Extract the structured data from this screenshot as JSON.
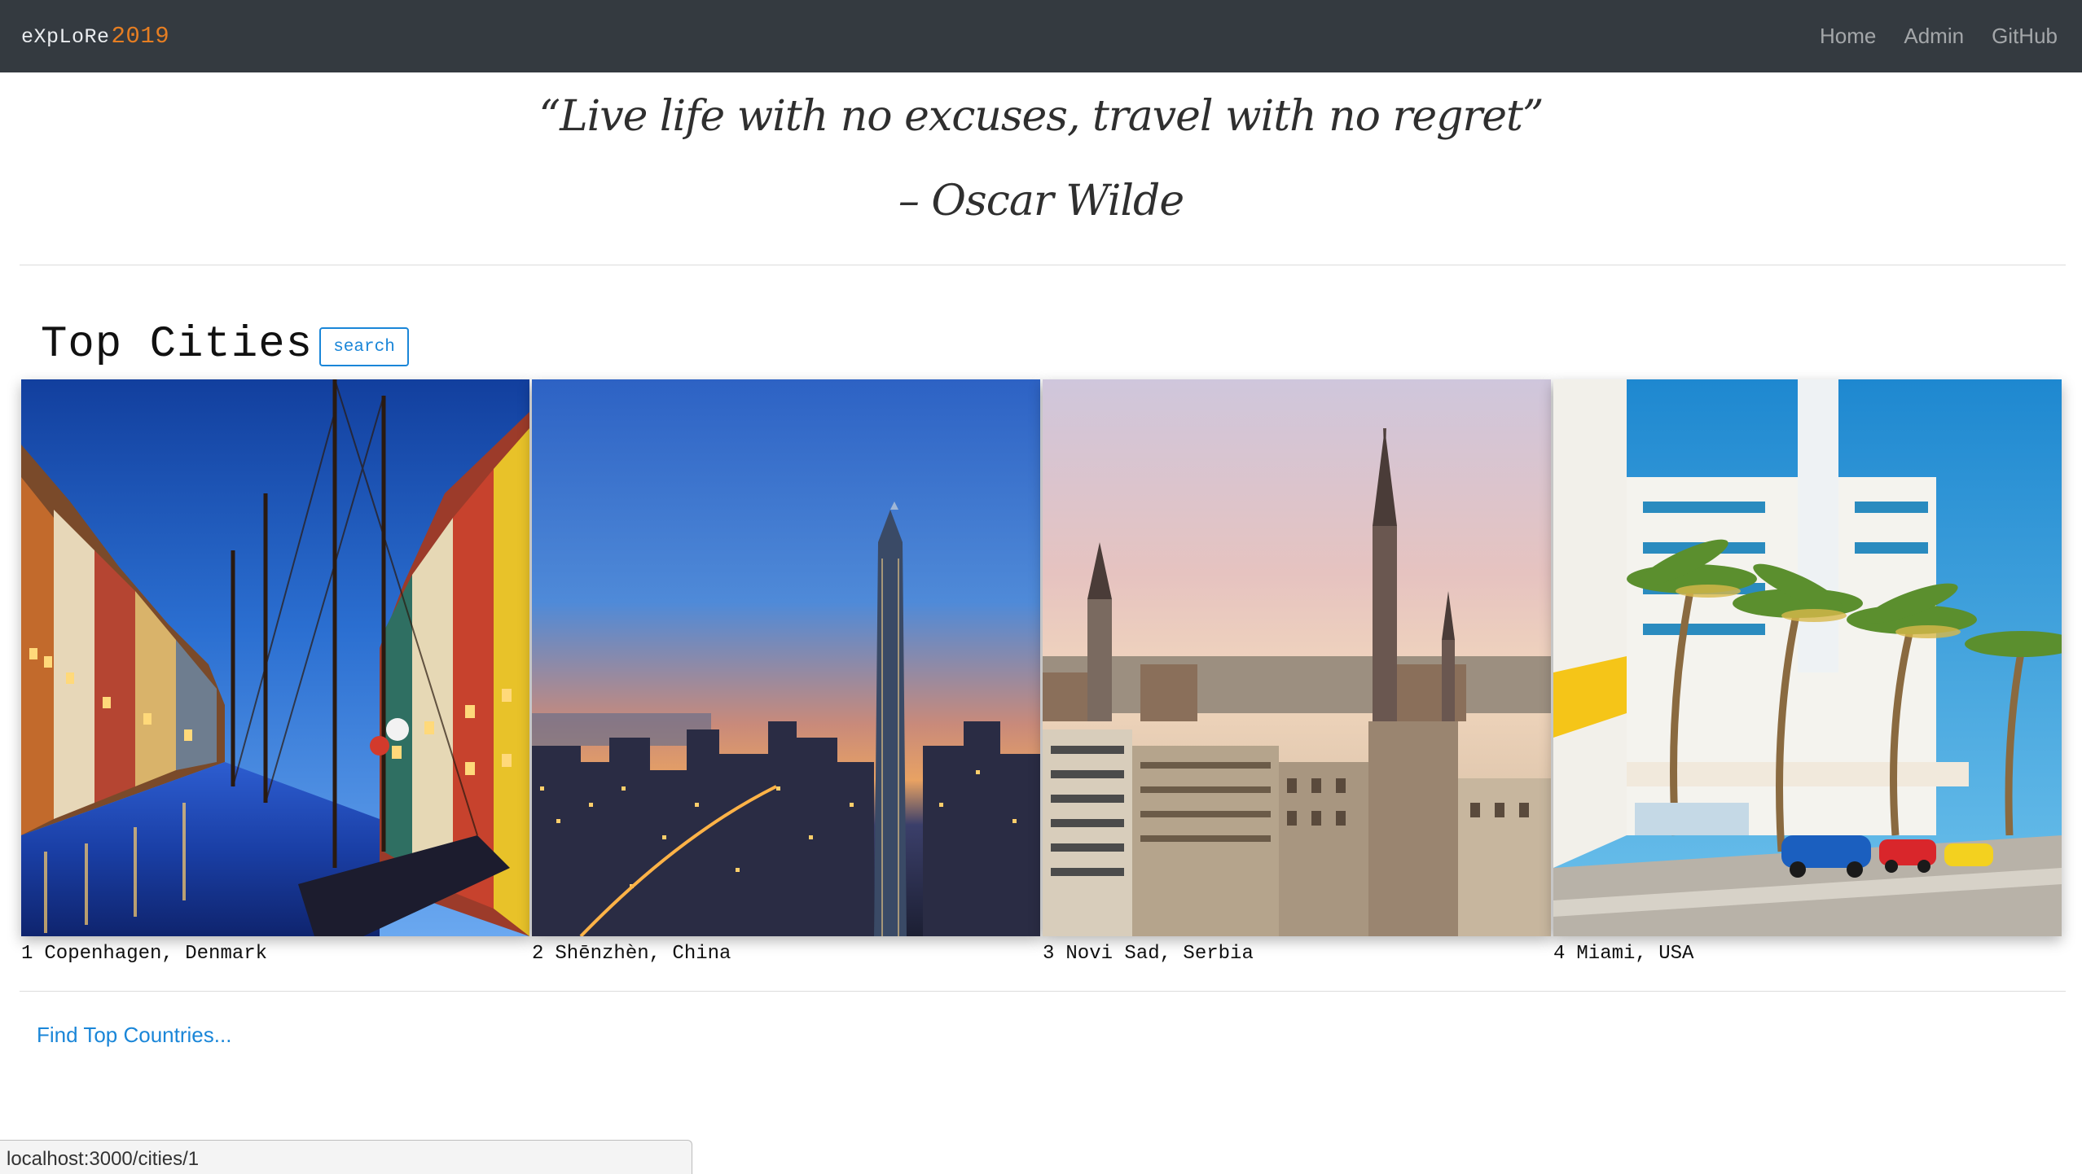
{
  "navbar": {
    "brand_text": "eXpLoRe",
    "brand_year": "2019",
    "links": [
      {
        "label": "Home"
      },
      {
        "label": "Admin"
      },
      {
        "label": "GitHub"
      }
    ]
  },
  "quote": {
    "text": "“Live life with no excuses, travel with no regret”",
    "author": "– Oscar Wilde"
  },
  "top_cities": {
    "title": "Top Cities",
    "search_label": "search",
    "cities": [
      {
        "rank": "1",
        "name": "Copenhagen, Denmark"
      },
      {
        "rank": "2",
        "name": "Shēnzhèn, China"
      },
      {
        "rank": "3",
        "name": "Novi Sad, Serbia"
      },
      {
        "rank": "4",
        "name": "Miami, USA"
      }
    ]
  },
  "footer_link": "Find Top Countries...",
  "status_bar_url": "localhost:3000/cities/1",
  "colors": {
    "navbar_bg": "#343a40",
    "brand_accent": "#e67e22",
    "link_blue": "#1a86d8"
  }
}
